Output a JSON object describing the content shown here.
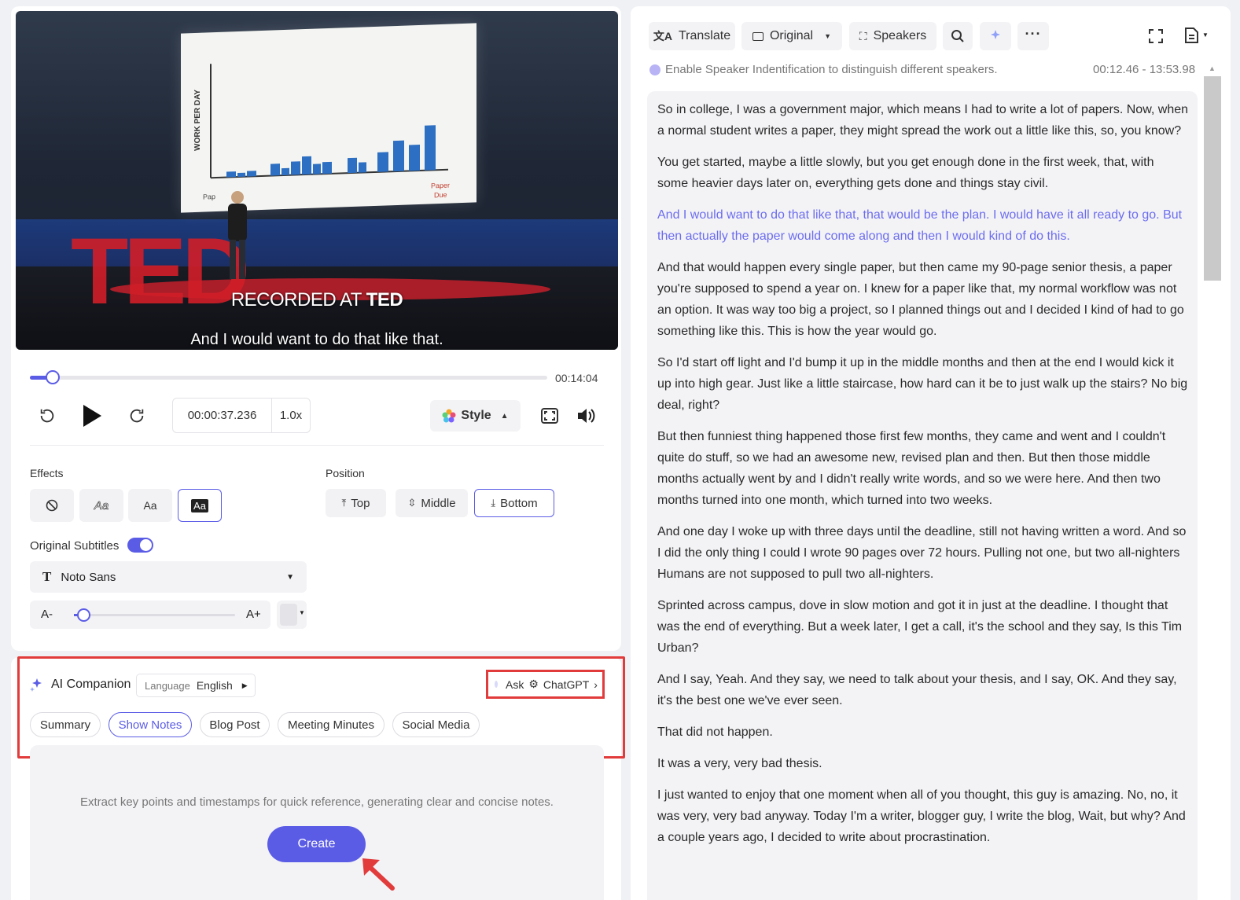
{
  "video": {
    "watermark_prefix": "RECORDED AT ",
    "watermark_brand": "TED",
    "subtitle": "And I would want to do that like that.",
    "chart_ylabel": "WORK PER DAY",
    "chart_label_left": "Paper Assigned",
    "chart_label_right": "Paper Due"
  },
  "player": {
    "progress": 0.044,
    "duration": "00:14:04",
    "current_time": "00:00:37.236",
    "speed": "1.0x",
    "style_label": "Style"
  },
  "effects": {
    "label": "Effects",
    "options": [
      "none",
      "outline",
      "plain",
      "background"
    ],
    "option_labels": [
      "",
      "Aa",
      "Aa",
      "Aa"
    ],
    "selected": 3
  },
  "position": {
    "label": "Position",
    "options": [
      {
        "label": "Top",
        "icon": "arrow-up-bar-icon"
      },
      {
        "label": "Middle",
        "icon": "arrows-center-icon"
      },
      {
        "label": "Bottom",
        "icon": "arrow-down-bar-icon"
      }
    ],
    "selected": "Bottom"
  },
  "subtitles": {
    "original_label": "Original Subtitles",
    "original_enabled": true,
    "font": "Noto Sans",
    "size_minus": "A-",
    "size_plus": "A+",
    "size_level": 0.06
  },
  "ai": {
    "title": "AI Companion",
    "language_label": "Language",
    "language_value": "English",
    "ask_label": "Ask",
    "ask_target": "ChatGPT",
    "tabs": [
      "Summary",
      "Show Notes",
      "Blog Post",
      "Meeting Minutes",
      "Social Media"
    ],
    "selected_tab": "Show Notes",
    "description": "Extract key points and timestamps for quick reference, generating clear and concise notes.",
    "create_label": "Create"
  },
  "toolbar": {
    "translate": "Translate",
    "original": "Original",
    "speakers": "Speakers"
  },
  "hint": "Enable Speaker Indentification to distinguish different speakers.",
  "time_range": "00:12.46 - 13:53.98",
  "transcript": [
    "So in college, I was a government major, which means I had to write a lot of papers. Now, when a normal student writes a paper, they might spread the work out a little like this, so, you know?",
    "You get started, maybe a little slowly, but you get enough done in the first week, that, with some heavier days later on, everything gets done and things stay civil.",
    "And I would want to do that like that, that would be the plan. I would have it all ready to go. But then actually the paper would come along and then I would kind of do this.",
    "And that would happen every single paper, but then came my 90-page senior thesis, a paper you're supposed to spend a year on. I knew for a paper like that, my normal workflow was not an option. It was way too big a project, so I planned things out and I decided I kind of had to go something like this. This is how the year would go.",
    "So I'd start off light and I'd bump it up in the middle months and then at the end I would kick it up into high gear. Just like a little staircase, how hard can it be to just walk up the stairs? No big deal, right?",
    "But then funniest thing happened those first few months, they came and went and I couldn't quite do stuff, so we had an awesome new, revised plan and then. But then those middle months actually went by and I didn't really write words, and so we were here. And then two months turned into one month, which turned into two weeks.",
    "And one day I woke up with three days until the deadline, still not having written a word. And so I did the only thing I could I wrote 90 pages over 72 hours. Pulling not one, but two all-nighters Humans are not supposed to pull two all-nighters.",
    "Sprinted across campus, dove in slow motion and got it in just at the deadline. I thought that was the end of everything. But a week later, I get a call, it's the school and they say, Is this Tim Urban?",
    "And I say, Yeah. And they say, we need to talk about your thesis, and I say, OK. And they say, it's the best one we've ever seen.",
    "That did not happen.",
    "It was a very, very bad thesis.",
    "I just wanted to enjoy that one moment when all of you thought, this guy is amazing. No, no, it was very, very bad anyway. Today I'm a writer, blogger guy, I write the blog, Wait, but why? And a couple years ago, I decided to write about procrastination."
  ],
  "active_paragraph": 2,
  "colors": {
    "accent": "#5b5ce6",
    "highlight_text": "#6c6cf0",
    "annotation": "#e23b3b"
  }
}
